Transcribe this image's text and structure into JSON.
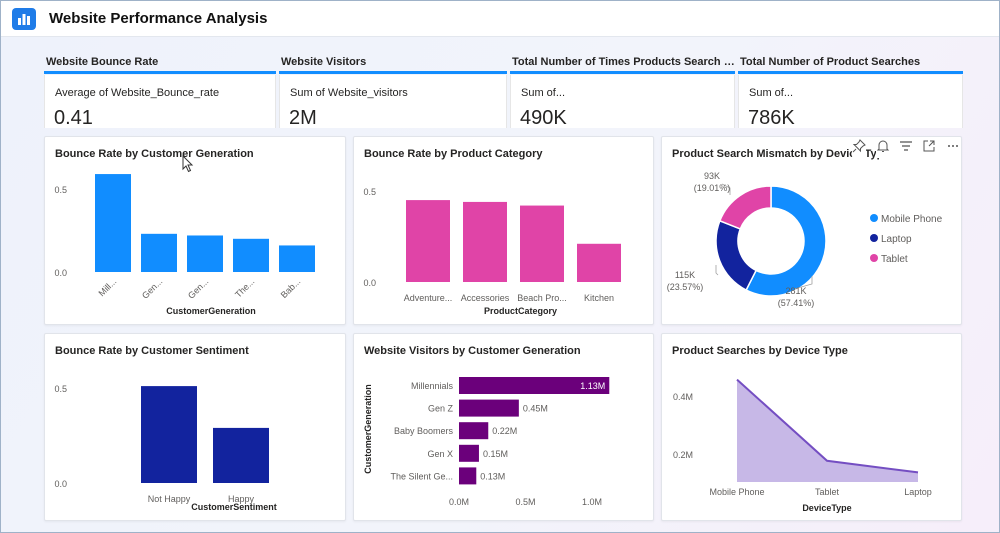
{
  "header": {
    "title": "Website Performance Analysis",
    "icon": "bar-chart-icon"
  },
  "kpis": [
    {
      "head": "Website Bounce Rate",
      "label": "Average of Website_Bounce_rate",
      "value": "0.41"
    },
    {
      "head": "Website Visitors",
      "label": "Sum of Website_visitors",
      "value": "2M"
    },
    {
      "head": "Total Number of Times Products Search Did ...",
      "label": "Sum of...",
      "value": "490K"
    },
    {
      "head": "Total Number of Product Searches",
      "label": "Sum of...",
      "value": "786K"
    }
  ],
  "colors": {
    "accent": "#118dff",
    "pink": "#e044a7",
    "navy": "#12239e",
    "purple": "#6b007b",
    "lavender": "#c9b6e6",
    "line": "#744ec2"
  },
  "chart_data": [
    {
      "title": "Bounce Rate by Customer Generation",
      "type": "bar",
      "categories": [
        "Mill...",
        "Gen...",
        "Gen...",
        "The...",
        "Bab..."
      ],
      "values": [
        0.59,
        0.23,
        0.22,
        0.2,
        0.16
      ],
      "xlabel": "CustomerGeneration",
      "ylim": [
        0,
        0.5
      ],
      "yticks": [
        "0.0",
        "0.5"
      ],
      "color": "#118dff"
    },
    {
      "title": "Bounce Rate by Product Category",
      "type": "bar",
      "categories": [
        "Adventure...",
        "Accessories",
        "Beach Pro...",
        "Kitchen"
      ],
      "values": [
        0.45,
        0.44,
        0.42,
        0.21
      ],
      "xlabel": "ProductCategory",
      "ylim": [
        0,
        0.5
      ],
      "yticks": [
        "0.0",
        "0.5"
      ],
      "color": "#e044a7"
    },
    {
      "title": "Product Search Mismatch by Device Type",
      "type": "pie",
      "labels": [
        "Mobile Phone",
        "Laptop",
        "Tablet"
      ],
      "values": [
        281,
        115,
        93
      ],
      "value_labels": [
        "281K",
        "115K",
        "93K"
      ],
      "percent_labels": [
        "(57.41%)",
        "(23.57%)",
        "(19.01%)"
      ],
      "colors": [
        "#118dff",
        "#12239e",
        "#e044a7"
      ],
      "legend": "right"
    },
    {
      "title": "Bounce Rate by Customer Sentiment",
      "type": "bar",
      "categories": [
        "Not Happy",
        "Happy"
      ],
      "values": [
        0.51,
        0.29
      ],
      "xlabel": "CustomerSentiment",
      "ylim": [
        0,
        0.5
      ],
      "yticks": [
        "0.0",
        "0.5"
      ],
      "color": "#12239e"
    },
    {
      "title": "Website Visitors by Customer Generation",
      "type": "bar",
      "orientation": "horizontal",
      "categories": [
        "Millennials",
        "Gen Z",
        "Baby Boomers",
        "Gen X",
        "The Silent Ge..."
      ],
      "values": [
        1.13,
        0.45,
        0.22,
        0.15,
        0.13
      ],
      "value_labels": [
        "1.13M",
        "0.45M",
        "0.22M",
        "0.15M",
        "0.13M"
      ],
      "ylabel": "CustomerGeneration",
      "xticks": [
        "0.0M",
        "0.5M",
        "1.0M"
      ],
      "xlim": [
        0,
        1.0
      ],
      "color": "#6b007b"
    },
    {
      "title": "Product Searches by Device Type",
      "type": "area",
      "categories": [
        "Mobile Phone",
        "Tablet",
        "Laptop"
      ],
      "values": [
        0.46,
        0.18,
        0.14
      ],
      "xlabel": "DeviceType",
      "yticks": [
        "0.2M",
        "0.4M"
      ],
      "color": "#744ec2"
    }
  ]
}
